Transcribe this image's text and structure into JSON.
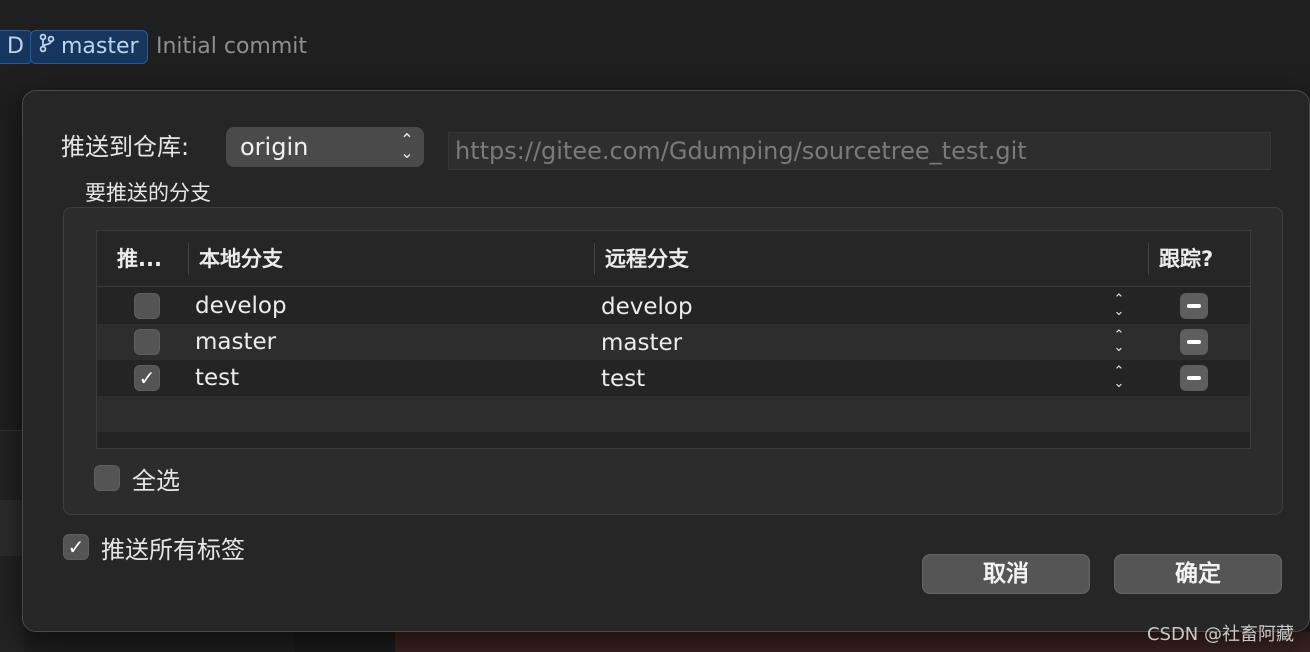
{
  "window": {
    "head_badge": "D",
    "branch_badge": "master",
    "commit_message": "Initial commit"
  },
  "dialog": {
    "repo_label": "推送到仓库:",
    "repo_selected": "origin",
    "repo_url": "https://gitee.com/Gdumping/sourcetree_test.git",
    "branches_label": "要推送的分支",
    "table": {
      "headers": {
        "push": "推...",
        "local": "本地分支",
        "remote": "远程分支",
        "track": "跟踪?"
      },
      "rows": [
        {
          "push": false,
          "local": "develop",
          "remote": "develop",
          "track": "indeterminate"
        },
        {
          "push": false,
          "local": "master",
          "remote": "master",
          "track": "indeterminate"
        },
        {
          "push": true,
          "local": "test",
          "remote": "test",
          "track": "indeterminate"
        }
      ]
    },
    "select_all_label": "全选",
    "select_all_checked": false,
    "push_tags_label": "推送所有标签",
    "push_tags_checked": true,
    "cancel_label": "取消",
    "ok_label": "确定"
  },
  "watermark": "CSDN @社畜阿藏",
  "icons": {
    "checkmark": "✓",
    "branch": "branch-icon",
    "stepper": "chevron-updown-icon",
    "indeterminate": "minus-icon"
  },
  "colors": {
    "dialog_bg": "#262626",
    "badge_bg": "#17365d",
    "control_bg": "#4a4a4a"
  }
}
